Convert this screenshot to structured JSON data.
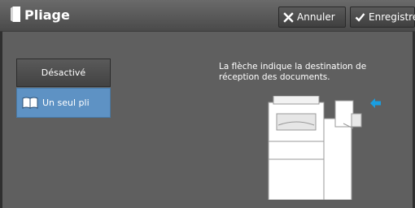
{
  "header": {
    "title": "Pliage",
    "cancel_label": "Annuler",
    "save_label": "Enregistrer"
  },
  "options": {
    "off_label": "Désactivé",
    "single_fold_label": "Un seul pli"
  },
  "info_text": "La flèche indique la destination de réception des documents.",
  "colors": {
    "selected": "#5e92c4",
    "arrow": "#1a9ee0"
  }
}
